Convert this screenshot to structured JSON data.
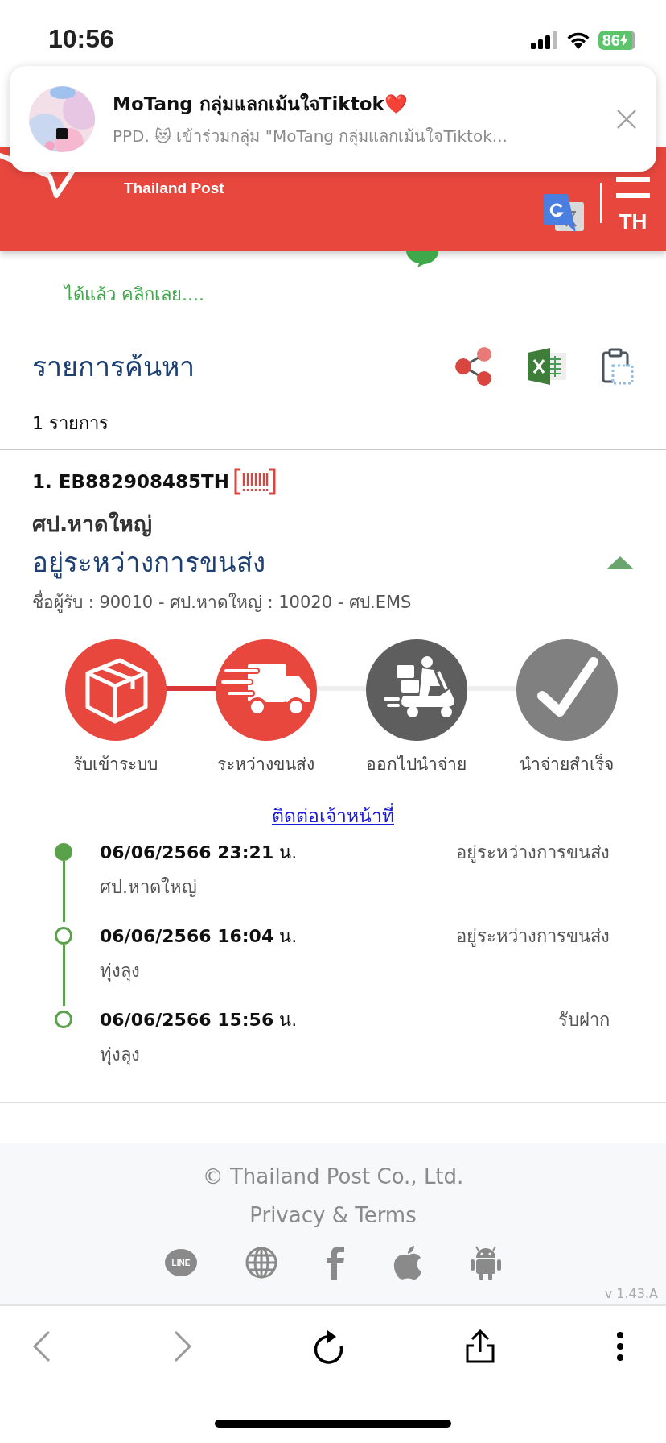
{
  "status_bar": {
    "time": "10:56",
    "battery": "86"
  },
  "notification": {
    "title": "MoTang กลุ่มแลกเม้นใจTiktok❤️",
    "message": "PPD. 😻 เข้าร่วมกลุ่ม \"MoTang กลุ่มแลกเม้นใจTiktok..."
  },
  "header": {
    "brand": "Thailand Post",
    "language": "TH"
  },
  "promo_link": "ได้แล้ว คลิกเลย....",
  "results": {
    "title": "รายการค้นหา",
    "count": "1 รายการ"
  },
  "parcel": {
    "number": "1. EB882908485TH",
    "office": "ศป.หาดใหญ่",
    "status": "อยู่ระหว่างการขนส่ง",
    "expanded": true,
    "route": "ชื่อผู้รับ : 90010 - ศป.หาดใหญ่ : 10020 - ศป.EMS",
    "steps": [
      {
        "kind": "box",
        "label": "รับเข้าระบบ",
        "done": true
      },
      {
        "kind": "truck",
        "label": "ระหว่างขนส่ง",
        "done": true
      },
      {
        "kind": "scooter",
        "label": "ออกไปนำจ่าย",
        "done": false,
        "color": "#5e5e5e"
      },
      {
        "kind": "check",
        "label": "นำจ่ายสำเร็จ",
        "done": false,
        "color": "#808080"
      }
    ],
    "contact_link": "ติดต่อเจ้าหน้าที่",
    "events": [
      {
        "datetime": "06/06/2566 23:21",
        "unit": "น.",
        "status": "อยู่ระหว่างการขนส่ง",
        "location": "ศป.หาดใหญ่",
        "current": true
      },
      {
        "datetime": "06/06/2566 16:04",
        "unit": "น.",
        "status": "อยู่ระหว่างการขนส่ง",
        "location": "ทุ่งลุง",
        "current": false
      },
      {
        "datetime": "06/06/2566 15:56",
        "unit": "น.",
        "status": "รับฝาก",
        "location": "ทุ่งลุง",
        "current": false
      }
    ]
  },
  "footer": {
    "copyright": "© Thailand Post Co., Ltd.",
    "privacy": "Privacy & Terms",
    "line_label": "LINE",
    "version": "v 1.43.A"
  },
  "browser_toolbar": [
    {
      "kind": "back",
      "disabled": true
    },
    {
      "kind": "forward",
      "disabled": true
    },
    {
      "kind": "reload",
      "disabled": false
    },
    {
      "kind": "share",
      "disabled": false
    },
    {
      "kind": "more",
      "disabled": false
    }
  ]
}
